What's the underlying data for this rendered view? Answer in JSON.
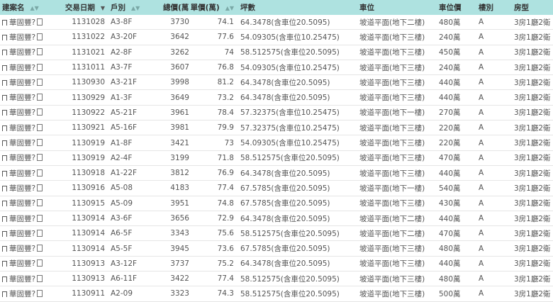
{
  "columns": {
    "name": "建案名",
    "date": "交易日期",
    "unit": "戶別",
    "total": "總價(萬)",
    "unit_price": "單價(萬)",
    "area": "坪數",
    "parking": "車位",
    "parking_price": "車位價",
    "floor_type": "樓別",
    "layout": "房型"
  },
  "rows": [
    {
      "name": "華固豐?",
      "date": "1131028",
      "unit": "A3-8F",
      "total": "3730",
      "unit_price": "74.1",
      "area": "64.3478(含車位20.5095)",
      "parking": "坡道平面(地下二樓)",
      "parking_price": "480萬",
      "floor_type": "A",
      "layout": "3房1廳2衛"
    },
    {
      "name": "華固豐?",
      "date": "1131022",
      "unit": "A3-20F",
      "total": "3642",
      "unit_price": "77.6",
      "area": "54.09305(含車位10.25475)",
      "parking": "坡道平面(地下三樓)",
      "parking_price": "240萬",
      "floor_type": "A",
      "layout": "3房1廳2衛"
    },
    {
      "name": "華固豐?",
      "date": "1131021",
      "unit": "A2-8F",
      "total": "3262",
      "unit_price": "74",
      "area": "58.512575(含車位20.5095)",
      "parking": "坡道平面(地下三樓)",
      "parking_price": "450萬",
      "floor_type": "A",
      "layout": "3房1廳2衛"
    },
    {
      "name": "華固豐?",
      "date": "1131011",
      "unit": "A3-7F",
      "total": "3607",
      "unit_price": "76.8",
      "area": "54.09305(含車位10.25475)",
      "parking": "坡道平面(地下三樓)",
      "parking_price": "240萬",
      "floor_type": "A",
      "layout": "3房1廳2衛"
    },
    {
      "name": "華固豐?",
      "date": "1130930",
      "unit": "A3-21F",
      "total": "3998",
      "unit_price": "81.2",
      "area": "64.3478(含車位20.5095)",
      "parking": "坡道平面(地下三樓)",
      "parking_price": "440萬",
      "floor_type": "A",
      "layout": "3房1廳2衛"
    },
    {
      "name": "華固豐?",
      "date": "1130929",
      "unit": "A1-3F",
      "total": "3649",
      "unit_price": "73.2",
      "area": "64.3478(含車位20.5095)",
      "parking": "坡道平面(地下三樓)",
      "parking_price": "440萬",
      "floor_type": "A",
      "layout": "3房1廳2衛"
    },
    {
      "name": "華固豐?",
      "date": "1130922",
      "unit": "A5-21F",
      "total": "3961",
      "unit_price": "78.4",
      "area": "57.32375(含車位10.25475)",
      "parking": "坡道平面(地下一樓)",
      "parking_price": "270萬",
      "floor_type": "A",
      "layout": "3房1廳2衛"
    },
    {
      "name": "華固豐?",
      "date": "1130921",
      "unit": "A5-16F",
      "total": "3981",
      "unit_price": "79.9",
      "area": "57.32375(含車位10.25475)",
      "parking": "坡道平面(地下三樓)",
      "parking_price": "220萬",
      "floor_type": "A",
      "layout": "3房1廳2衛"
    },
    {
      "name": "華固豐?",
      "date": "1130919",
      "unit": "A1-8F",
      "total": "3421",
      "unit_price": "73",
      "area": "54.09305(含車位10.25475)",
      "parking": "坡道平面(地下三樓)",
      "parking_price": "220萬",
      "floor_type": "A",
      "layout": "3房1廳2衛"
    },
    {
      "name": "華固豐?",
      "date": "1130919",
      "unit": "A2-4F",
      "total": "3199",
      "unit_price": "71.8",
      "area": "58.512575(含車位20.5095)",
      "parking": "坡道平面(地下三樓)",
      "parking_price": "470萬",
      "floor_type": "A",
      "layout": "3房1廳2衛"
    },
    {
      "name": "華固豐?",
      "date": "1130918",
      "unit": "A1-22F",
      "total": "3812",
      "unit_price": "76.9",
      "area": "64.3478(含車位20.5095)",
      "parking": "坡道平面(地下三樓)",
      "parking_price": "440萬",
      "floor_type": "A",
      "layout": "3房1廳2衛"
    },
    {
      "name": "華固豐?",
      "date": "1130916",
      "unit": "A5-08",
      "total": "4183",
      "unit_price": "77.4",
      "area": "67.5785(含車位20.5095)",
      "parking": "坡道平面(地下一樓)",
      "parking_price": "540萬",
      "floor_type": "A",
      "layout": "3房1廳2衛"
    },
    {
      "name": "華固豐?",
      "date": "1130915",
      "unit": "A5-09",
      "total": "3951",
      "unit_price": "74.8",
      "area": "67.5785(含車位20.5095)",
      "parking": "坡道平面(地下三樓)",
      "parking_price": "430萬",
      "floor_type": "A",
      "layout": "3房1廳2衛"
    },
    {
      "name": "華固豐?",
      "date": "1130914",
      "unit": "A3-6F",
      "total": "3656",
      "unit_price": "72.9",
      "area": "64.3478(含車位20.5095)",
      "parking": "坡道平面(地下二樓)",
      "parking_price": "440萬",
      "floor_type": "A",
      "layout": "3房1廳2衛"
    },
    {
      "name": "華固豐?",
      "date": "1130914",
      "unit": "A6-5F",
      "total": "3343",
      "unit_price": "75.6",
      "area": "58.512575(含車位20.5095)",
      "parking": "坡道平面(地下二樓)",
      "parking_price": "470萬",
      "floor_type": "A",
      "layout": "3房1廳2衛"
    },
    {
      "name": "華固豐?",
      "date": "1130914",
      "unit": "A5-5F",
      "total": "3945",
      "unit_price": "73.6",
      "area": "67.5785(含車位20.5095)",
      "parking": "坡道平面(地下三樓)",
      "parking_price": "480萬",
      "floor_type": "A",
      "layout": "3房1廳2衛"
    },
    {
      "name": "華固豐?",
      "date": "1130913",
      "unit": "A3-12F",
      "total": "3737",
      "unit_price": "75.2",
      "area": "64.3478(含車位20.5095)",
      "parking": "坡道平面(地下三樓)",
      "parking_price": "440萬",
      "floor_type": "A",
      "layout": "3房1廳2衛"
    },
    {
      "name": "華固豐?",
      "date": "1130913",
      "unit": "A6-11F",
      "total": "3422",
      "unit_price": "77.4",
      "area": "58.512575(含車位20.5095)",
      "parking": "坡道平面(地下三樓)",
      "parking_price": "480萬",
      "floor_type": "A",
      "layout": "3房1廳2衛"
    },
    {
      "name": "華固豐?",
      "date": "1130911",
      "unit": "A2-09",
      "total": "3323",
      "unit_price": "74.3",
      "area": "58.512575(含車位20.5095)",
      "parking": "坡道平面(地下三樓)",
      "parking_price": "500萬",
      "floor_type": "A",
      "layout": "3房1廳2衛"
    }
  ],
  "colors": {
    "header_bg": "#aee2e0"
  },
  "icons": {
    "sort": "sort-icon",
    "sort_active": "sort-desc-icon",
    "bookmark": "bookmark-icon",
    "doc": "document-icon"
  }
}
